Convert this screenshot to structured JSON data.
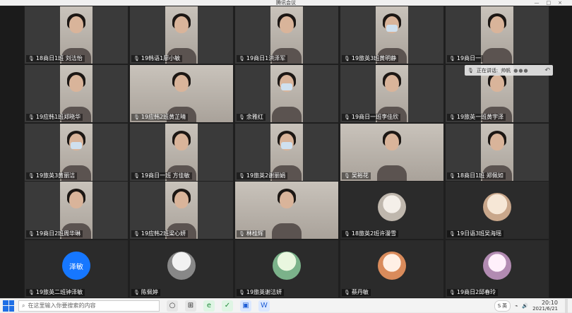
{
  "window": {
    "title": "腾讯会议",
    "controls": [
      "—",
      "□",
      "×"
    ]
  },
  "speaking_indicator": {
    "label": "正在讲话:",
    "speaker": "帅帆",
    "dots": "●●●"
  },
  "participants": [
    {
      "name": "18商日1班 刘洁怡",
      "type": "video",
      "mask": false
    },
    {
      "name": "19韩语1廖小敏",
      "type": "video",
      "mask": false
    },
    {
      "name": "19商日1洪泽军",
      "type": "video",
      "mask": false
    },
    {
      "name": "19旅英3班黄明静",
      "type": "video",
      "mask": true
    },
    {
      "name": "19商日一",
      "type": "video",
      "mask": false
    },
    {
      "name": "19应韩1班郑晓华",
      "type": "video",
      "mask": false
    },
    {
      "name": "19应韩2班黄芷晴",
      "type": "video",
      "mask": false,
      "wide": true
    },
    {
      "name": "余雅红",
      "type": "video",
      "mask": true
    },
    {
      "name": "19商日一班李佳欣",
      "type": "video",
      "mask": false
    },
    {
      "name": "19旅英一班黄宇泽",
      "type": "video",
      "mask": false
    },
    {
      "name": "19旅英3黄丽洁",
      "type": "video",
      "mask": true
    },
    {
      "name": "19商日一班 方佳敏",
      "type": "video",
      "mask": false
    },
    {
      "name": "19旅英2谢丽娟",
      "type": "video",
      "mask": true
    },
    {
      "name": "吴裕花",
      "type": "video",
      "mask": false,
      "wide": true
    },
    {
      "name": "18商日1班 郑佩如",
      "type": "video",
      "mask": false
    },
    {
      "name": "19商日2班周华琳",
      "type": "video",
      "mask": false
    },
    {
      "name": "19应韩2班梁心妍",
      "type": "video",
      "mask": false
    },
    {
      "name": "林桂辉",
      "type": "video",
      "mask": false,
      "wide": true
    },
    {
      "name": "18旅英2班许漫雪",
      "type": "avatar",
      "avatar_style": "photo1"
    },
    {
      "name": "19日语3班吴海瑶",
      "type": "avatar",
      "avatar_style": "photo2"
    },
    {
      "name": "19旅英二班钟泽敏",
      "type": "avatar",
      "avatar_style": "blue",
      "avatar_text": "泽敏"
    },
    {
      "name": "陈佩婷",
      "type": "avatar",
      "avatar_style": "photo4"
    },
    {
      "name": "19旅英谢洁妍",
      "type": "avatar",
      "avatar_style": "photo5"
    },
    {
      "name": "蔡丹敏",
      "type": "avatar",
      "avatar_style": "photo6"
    },
    {
      "name": "19商日2邱春玲",
      "type": "avatar",
      "avatar_style": "photo7"
    }
  ],
  "taskbar": {
    "search_placeholder": "在这里输入你要搜索的内容",
    "apps": [
      "○",
      "⊞",
      "e",
      "✓",
      "▣",
      "W"
    ],
    "ime_label": "英",
    "time": "20:10",
    "date": "2021/6/21"
  }
}
